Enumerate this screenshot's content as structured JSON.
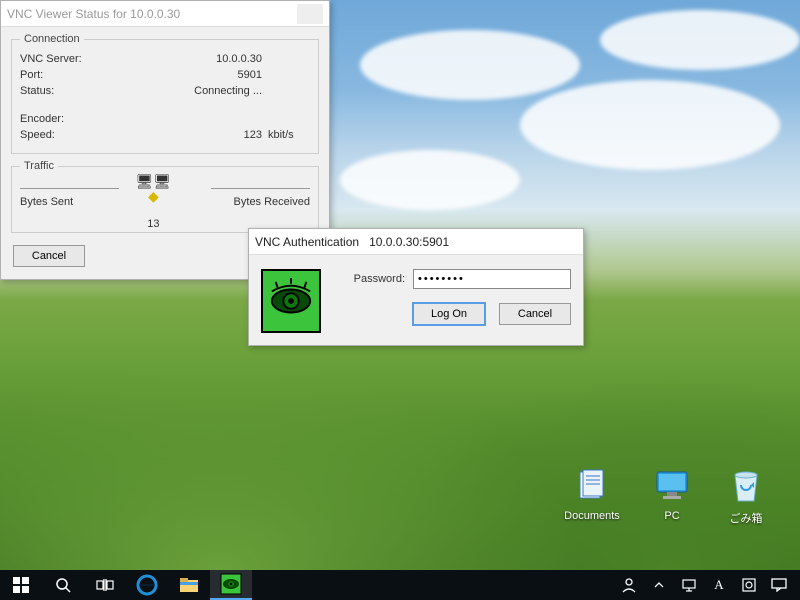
{
  "status_window": {
    "title": "VNC Viewer Status for 10.0.0.30",
    "connection": {
      "legend": "Connection",
      "server_label": "VNC Server:",
      "server_value": "10.0.0.30",
      "port_label": "Port:",
      "port_value": "5901",
      "status_label": "Status:",
      "status_value": "Connecting ...",
      "encoder_label": "Encoder:",
      "encoder_value": "",
      "speed_label": "Speed:",
      "speed_value": "123",
      "speed_unit": "kbit/s"
    },
    "traffic": {
      "legend": "Traffic",
      "bytes_sent_label": "Bytes Sent",
      "bytes_sent_value": "13",
      "bytes_received_label": "Bytes Received"
    },
    "cancel_label": "Cancel"
  },
  "auth_dialog": {
    "title_prefix": "VNC Authentication",
    "title_target": "10.0.0.30:5901",
    "password_label": "Password:",
    "password_value": "••••••••",
    "logon_label": "Log On",
    "cancel_label": "Cancel"
  },
  "desktop": {
    "documents_label": "Documents",
    "pc_label": "PC",
    "recycle_label": "ごみ箱"
  },
  "taskbar": {
    "ime_letter": "A"
  }
}
